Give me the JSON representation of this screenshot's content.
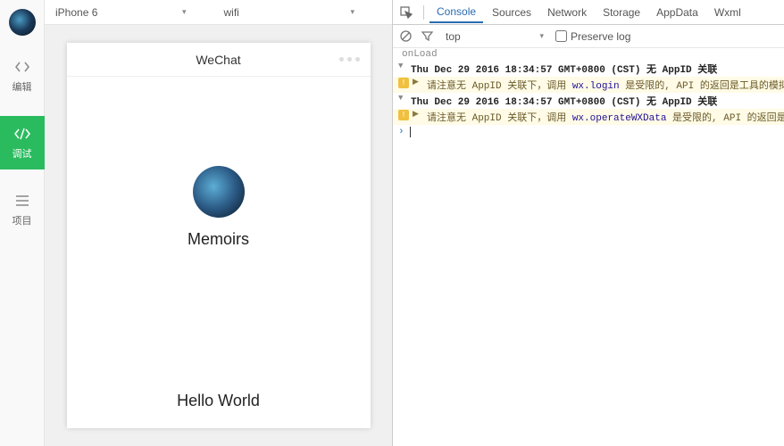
{
  "sidebar": {
    "items": [
      {
        "icon": "code-icon",
        "label": "编辑"
      },
      {
        "icon": "debug-icon",
        "label": "调试"
      },
      {
        "icon": "menu-icon",
        "label": "项目"
      }
    ]
  },
  "toolbar": {
    "device": "iPhone 6",
    "network": "wifi"
  },
  "preview": {
    "title": "WeChat",
    "username": "Memoirs",
    "hello": "Hello World"
  },
  "devtools": {
    "tabs": [
      "Console",
      "Sources",
      "Network",
      "Storage",
      "AppData",
      "Wxml"
    ],
    "activeTab": "Console",
    "context": "top",
    "preserve_label": "Preserve log",
    "console": {
      "onload": "onLoad",
      "lines": [
        {
          "type": "log",
          "text": "Thu Dec 29 2016 18:34:57 GMT+0800 (CST) 无 AppID 关联"
        },
        {
          "type": "warn",
          "prefix": "请注意无 AppID 关联下，调用 ",
          "api": "wx.login",
          "suffix": " 是受限的, API 的返回是工具的模拟返回"
        },
        {
          "type": "log",
          "text": "Thu Dec 29 2016 18:34:57 GMT+0800 (CST) 无 AppID 关联"
        },
        {
          "type": "warn",
          "prefix": "请注意无 AppID 关联下，调用 ",
          "api": "wx.operateWXData",
          "suffix": " 是受限的, API 的返回是工具"
        }
      ]
    }
  }
}
